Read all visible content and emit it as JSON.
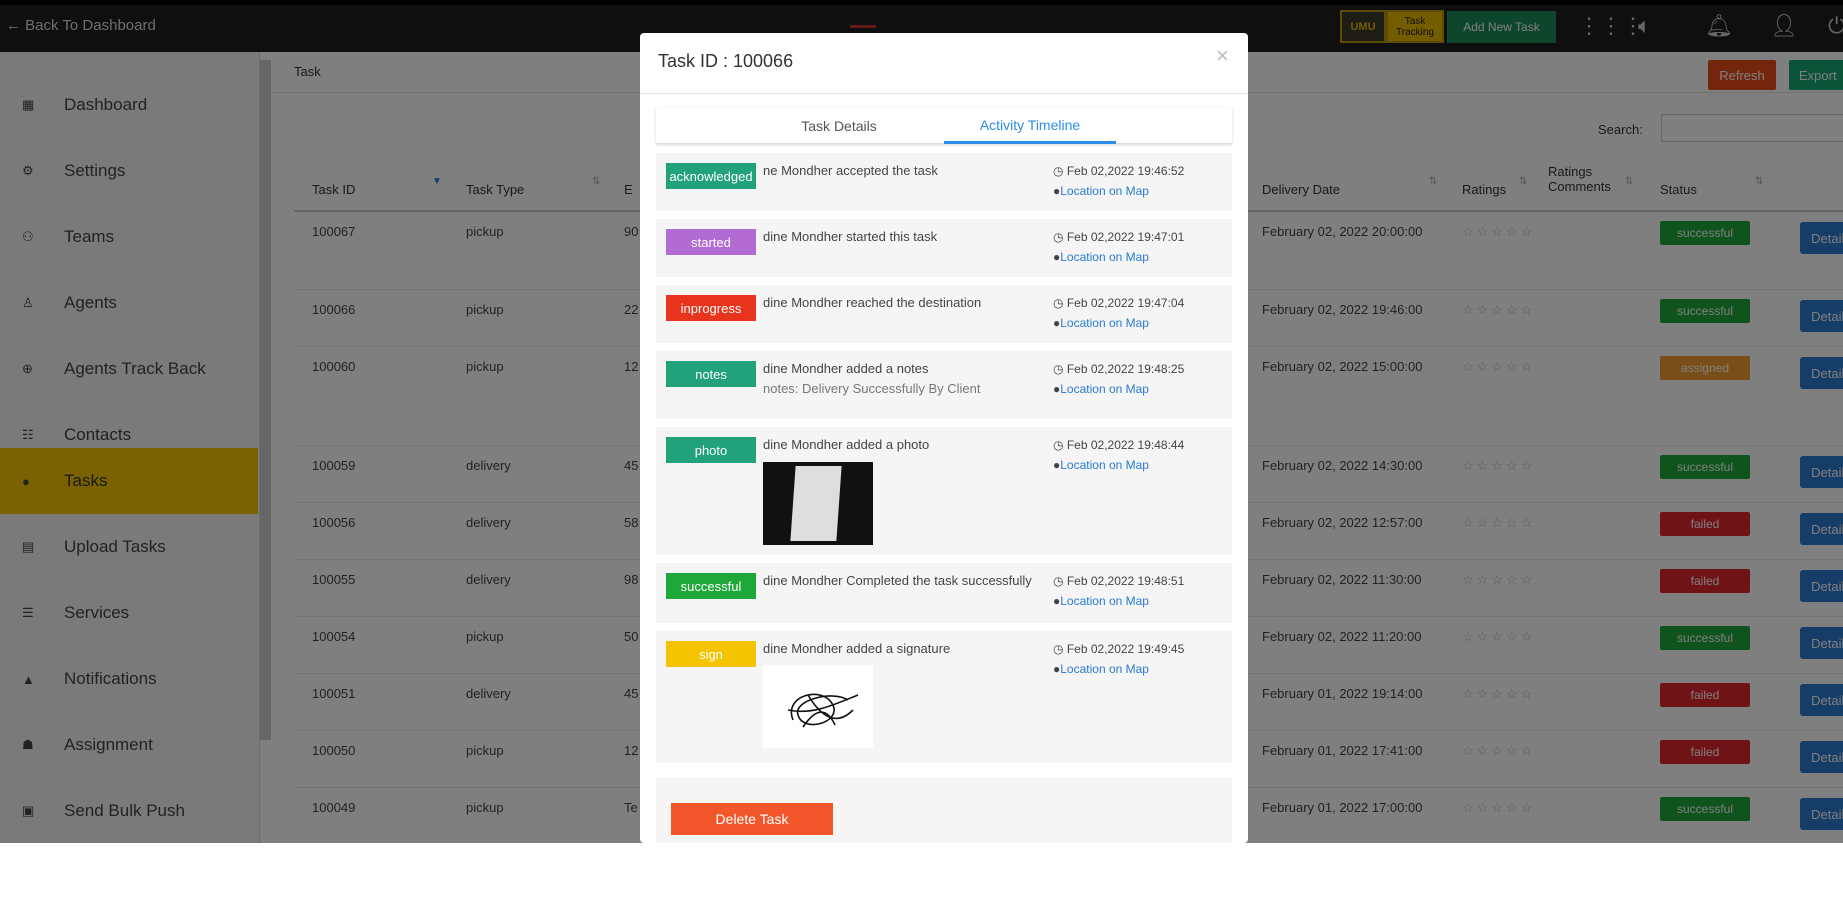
{
  "topbar": {
    "back_label": "← Back To Dashboard",
    "umu": "UMU",
    "tracking": "Task Tracking",
    "add_task": "Add New Task"
  },
  "sidebar": {
    "items": [
      {
        "icon": "grid-icon",
        "label": "Dashboard"
      },
      {
        "icon": "gear-icon",
        "label": "Settings"
      },
      {
        "icon": "people-icon",
        "label": "Teams"
      },
      {
        "icon": "user-icon",
        "label": "Agents"
      },
      {
        "icon": "location-icon",
        "label": "Agents Track Back"
      },
      {
        "icon": "contacts-icon",
        "label": "Contacts"
      },
      {
        "icon": "tasks-icon",
        "label": "Tasks"
      },
      {
        "icon": "upload-icon",
        "label": "Upload Tasks"
      },
      {
        "icon": "services-icon",
        "label": "Services"
      },
      {
        "icon": "bell-icon",
        "label": "Notifications"
      },
      {
        "icon": "assignment-icon",
        "label": "Assignment"
      },
      {
        "icon": "push-icon",
        "label": "Send Bulk Push"
      }
    ],
    "active_index": 6
  },
  "main": {
    "breadcrumb": "Task",
    "refresh": "Refresh",
    "export": "Export",
    "search_label": "Search:",
    "headers": {
      "task_id": "Task ID",
      "task_type": "Task Type",
      "e": "E",
      "delivery_date": "Delivery Date",
      "ratings": "Ratings",
      "ratings_comments": "Ratings Comments",
      "status": "Status"
    },
    "rows": [
      {
        "id": "100067",
        "type": "pickup",
        "e": "90",
        "date": "February 02, 2022 20:00:00",
        "status": "successful",
        "color": "#1fa83a",
        "details": "Details"
      },
      {
        "id": "100066",
        "type": "pickup",
        "e": "22",
        "date": "February 02, 2022 19:46:00",
        "status": "successful",
        "color": "#1fa83a",
        "details": "Details"
      },
      {
        "id": "100060",
        "type": "pickup",
        "e": "12",
        "date": "February 02, 2022 15:00:00",
        "status": "assigned",
        "color": "#f39c32",
        "details": "Details"
      },
      {
        "id": "100059",
        "type": "delivery",
        "e": "45",
        "date": "February 02, 2022 14:30:00",
        "status": "successful",
        "color": "#1fa83a",
        "details": "Details"
      },
      {
        "id": "100056",
        "type": "delivery",
        "e": "58",
        "date": "February 02, 2022 12:57:00",
        "status": "failed",
        "color": "#e0262d",
        "details": "Details"
      },
      {
        "id": "100055",
        "type": "delivery",
        "e": "98",
        "date": "February 02, 2022 11:30:00",
        "status": "failed",
        "color": "#e0262d",
        "details": "Details"
      },
      {
        "id": "100054",
        "type": "pickup",
        "e": "50",
        "date": "February 02, 2022 11:20:00",
        "status": "successful",
        "color": "#1fa83a",
        "details": "Details"
      },
      {
        "id": "100051",
        "type": "delivery",
        "e": "45",
        "date": "February 01, 2022 19:14:00",
        "status": "failed",
        "color": "#e0262d",
        "details": "Details"
      },
      {
        "id": "100050",
        "type": "pickup",
        "e": "12",
        "date": "February 01, 2022 17:41:00",
        "status": "failed",
        "color": "#e0262d",
        "details": "Details"
      },
      {
        "id": "100049",
        "type": "pickup",
        "e": "Te",
        "date": "February 01, 2022 17:00:00",
        "status": "successful",
        "color": "#1fa83a",
        "details": "Details"
      }
    ]
  },
  "modal": {
    "title": "Task ID : 100066",
    "close": "×",
    "tabs": [
      "Task Details",
      "Activity Timeline"
    ],
    "active_tab": 1,
    "activities": [
      {
        "badge": "acknowledged",
        "color": "#21a27a",
        "text": "ne Mondher accepted the task",
        "note": "",
        "time": "Feb 02,2022 19:46:52",
        "loc": "Location on Map"
      },
      {
        "badge": "started",
        "color": "#b36bd4",
        "text": "dine Mondher started this task",
        "note": "",
        "time": "Feb 02,2022 19:47:01",
        "loc": "Location on Map"
      },
      {
        "badge": "inprogress",
        "color": "#e8341c",
        "text": "dine Mondher reached the destination",
        "note": "",
        "time": "Feb 02,2022 19:47:04",
        "loc": "Location on Map"
      },
      {
        "badge": "notes",
        "color": "#21a27a",
        "text": "dine Mondher added a notes",
        "note": "notes: Delivery Successfully By Client",
        "time": "Feb 02,2022 19:48:25",
        "loc": "Location on Map"
      },
      {
        "badge": "photo",
        "color": "#21a27a",
        "text": "dine Mondher added a photo",
        "note": "",
        "time": "Feb 02,2022 19:48:44",
        "loc": "Location on Map"
      },
      {
        "badge": "successful",
        "color": "#1fa83a",
        "text": "dine Mondher Completed the task successfully",
        "note": "",
        "time": "Feb 02,2022 19:48:51",
        "loc": "Location on Map"
      },
      {
        "badge": "sign",
        "color": "#f5c400",
        "text": "dine Mondher added a signature",
        "note": "",
        "time": "Feb 02,2022 19:49:45",
        "loc": "Location on Map"
      }
    ],
    "delete": "Delete Task"
  }
}
